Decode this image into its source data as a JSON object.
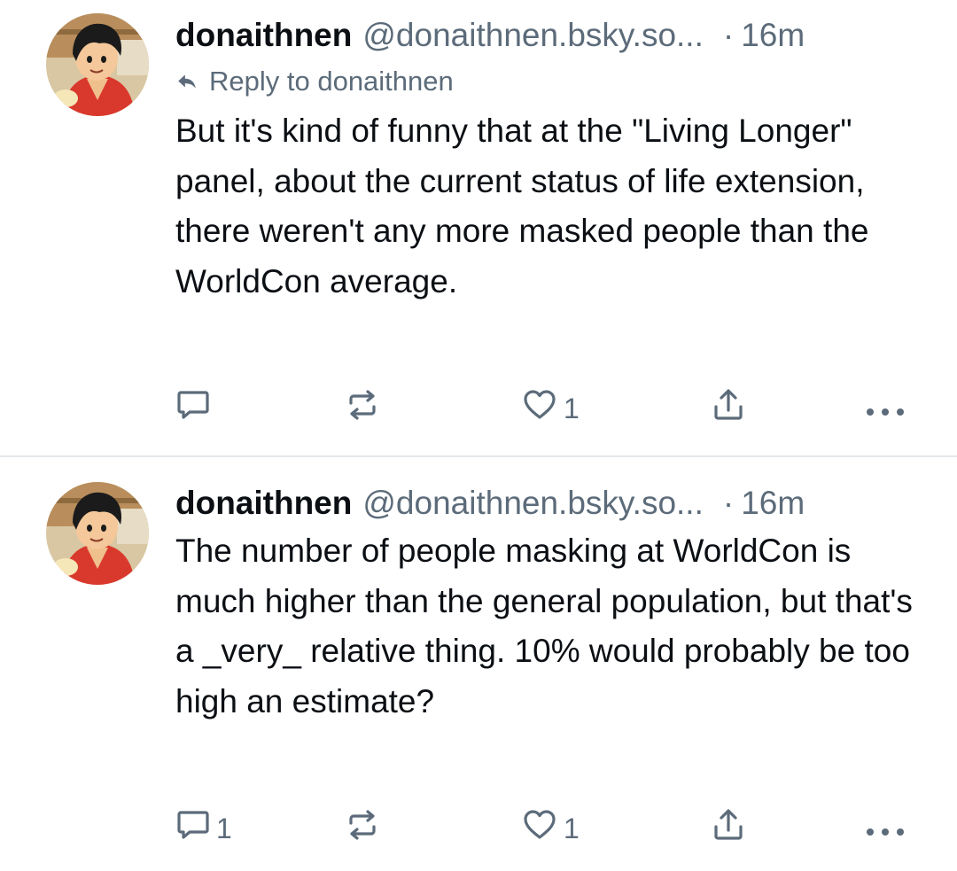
{
  "posts": [
    {
      "author_name": "donaithnen",
      "author_handle": "@donaithnen.bsky.so...",
      "dot": "·",
      "timestamp": "16m",
      "reply_to": "Reply to donaithnen",
      "text": "But it's kind of funny that at the \"Living Longer\" panel, about the current status of life extension, there weren't any more masked people than the WorldCon average.",
      "reply_count": "",
      "repost_count": "",
      "like_count": "1"
    },
    {
      "author_name": "donaithnen",
      "author_handle": "@donaithnen.bsky.so...",
      "dot": "·",
      "timestamp": "16m",
      "text": "The number of people masking at WorldCon is much higher than the general population, but that's a _very_ relative thing. 10% would probably be too high an estimate?",
      "reply_count": "1",
      "repost_count": "",
      "like_count": "1"
    }
  ],
  "icons": {
    "reply": "speech-bubble-icon",
    "repost": "repost-arrows-icon",
    "like": "heart-icon",
    "share": "share-upload-icon",
    "more": "ellipsis-icon",
    "reply_to": "reply-arrow-icon"
  },
  "colors": {
    "text": "#0b0f14",
    "muted": "#5c6b7a",
    "divider": "#e4e8ec"
  }
}
